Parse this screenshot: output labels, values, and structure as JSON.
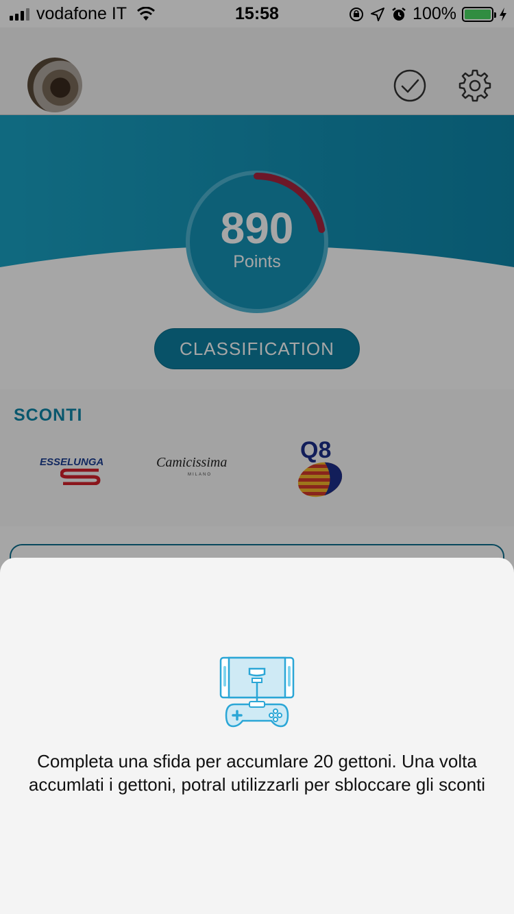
{
  "status_bar": {
    "carrier": "vodafone IT",
    "time": "15:58",
    "battery": "100%"
  },
  "header": {
    "avatar": "avatar",
    "icons": [
      "check-circle-icon",
      "gear-icon"
    ]
  },
  "score": {
    "value": "890",
    "label": "Points",
    "progress_fraction": 0.22,
    "ring_color": "#a8243e"
  },
  "classification_button": {
    "label": "CLASSIFICATION"
  },
  "sconti": {
    "title": "SCONTI",
    "logos": [
      {
        "name": "Esselunga",
        "text": "ESSELUNGA"
      },
      {
        "name": "Camicissima",
        "text": "Camicissima",
        "subtext": "MILANO"
      },
      {
        "name": "Q8",
        "text": "Q8"
      }
    ]
  },
  "sheet": {
    "icon": "game-controller-icon",
    "message": "Completa una sfida per accumlare 20 gettoni. Una volta accumlati i gettoni, potral utilizzarli per sbloccare gli sconti"
  },
  "colors": {
    "brand_teal": "#0e86a8",
    "ring_accent": "#a8243e",
    "icon_blue": "#2aa6d6"
  }
}
